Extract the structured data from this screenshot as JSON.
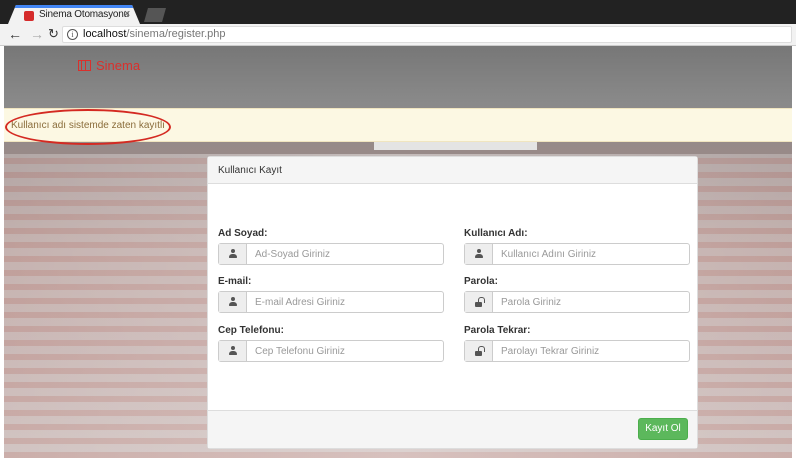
{
  "browser": {
    "tab_title": "Sinema Otomasyonu",
    "tab_close": "×",
    "url_host": "localhost",
    "url_path": "/sinema/register.php"
  },
  "brand": {
    "name": "Sinema",
    "icon": "film-icon"
  },
  "alert": {
    "message": "Kullanıcı adı sistemde zaten kayıtlı",
    "color": "#8a6d3b"
  },
  "form": {
    "title": "Kullanıcı Kayıt",
    "fields": {
      "fullname": {
        "label": "Ad Soyad:",
        "placeholder": "Ad-Soyad Giriniz",
        "icon": "user-icon"
      },
      "username": {
        "label": "Kullanıcı Adı:",
        "placeholder": "Kullanıcı Adını Giriniz",
        "icon": "user-icon"
      },
      "email": {
        "label": "E-mail:",
        "placeholder": "E-mail Adresi Giriniz",
        "icon": "user-icon"
      },
      "password": {
        "label": "Parola:",
        "placeholder": "Parola Giriniz",
        "icon": "lock-icon"
      },
      "phone": {
        "label": "Cep Telefonu:",
        "placeholder": "Cep Telefonu Giriniz",
        "icon": "user-icon"
      },
      "password_repeat": {
        "label": "Parola Tekrar:",
        "placeholder": "Parolayı Tekrar Giriniz",
        "icon": "lock-icon"
      }
    },
    "submit_label": "Kayıt Ol",
    "submit_color": "#5cb85c"
  }
}
